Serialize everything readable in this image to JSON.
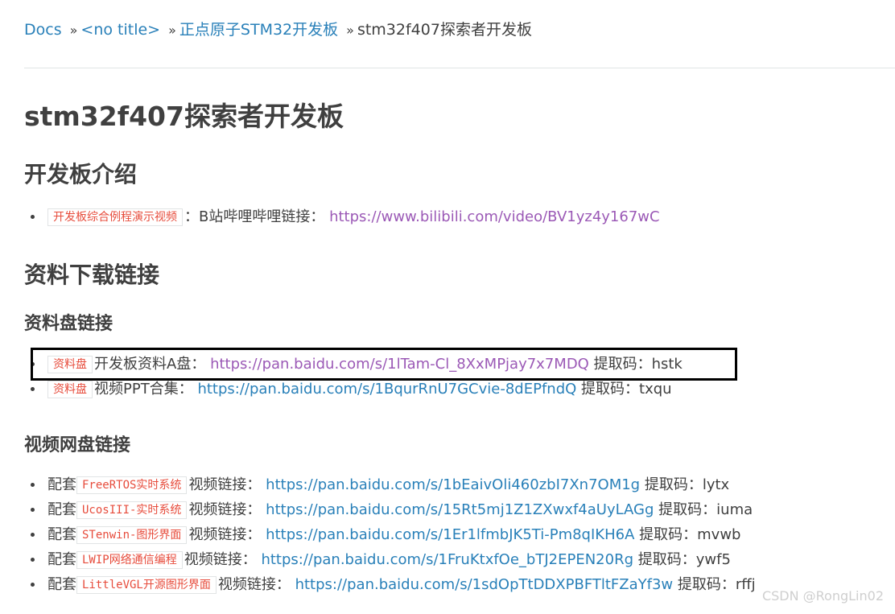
{
  "breadcrumb": {
    "items": [
      "Docs",
      "<no title>",
      "正点原子STM32开发板"
    ],
    "current": "stm32f407探索者开发板",
    "separator": "»"
  },
  "title": "stm32f407探索者开发板",
  "section_intro": {
    "heading": "开发板介绍",
    "items": [
      {
        "tag": "开发板综合例程演示视频",
        "prefix": "",
        "text": "：B站哔哩哔哩链接：",
        "link": "https://www.bilibili.com/video/BV1yz4y167wC",
        "suffix": ""
      }
    ]
  },
  "section_download": {
    "heading": "资料下载链接",
    "disk_links": {
      "heading": "资料盘链接",
      "items": [
        {
          "tag": "资料盘",
          "text": "开发板资料A盘：",
          "link": "https://pan.baidu.com/s/1lTam-Cl_8XxMPjay7x7MDQ",
          "suffix": "提取码：hstk"
        },
        {
          "tag": "资料盘",
          "text": "视频PPT合集：",
          "link": "https://pan.baidu.com/s/1BqurRnU7GCvie-8dEPfndQ",
          "suffix": "提取码：txqu"
        }
      ]
    },
    "video_links": {
      "heading": "视频网盘链接",
      "items": [
        {
          "prefix": "配套",
          "tag": "FreeRTOS实时系统",
          "text": "视频链接：",
          "link": "https://pan.baidu.com/s/1bEaivOli460zbI7Xn7OM1g",
          "suffix": "提取码：lytx"
        },
        {
          "prefix": "配套",
          "tag": "UcosIII-实时系统",
          "text": "视频链接：",
          "link": "https://pan.baidu.com/s/15Rt5mj1Z1ZXwxf4aUyLAGg",
          "suffix": "提取码：iuma"
        },
        {
          "prefix": "配套",
          "tag": "STenwin-图形界面",
          "text": "视频链接：",
          "link": "https://pan.baidu.com/s/1Er1lfmbJK5Ti-Pm8qIKH6A",
          "suffix": "提取码：mvwb"
        },
        {
          "prefix": "配套",
          "tag": "LWIP网络通信编程",
          "text": "视频链接：",
          "link": "https://pan.baidu.com/s/1FruKtxfOe_bTJ2EPEN20Rg",
          "suffix": "提取码：ywf5"
        },
        {
          "prefix": "配套",
          "tag": "LittleVGL开源图形界面",
          "text": "视频链接：",
          "link": "https://pan.baidu.com/s/1sdOpTtDDXPBFTltFZaYf3w",
          "suffix": "提取码：rffj"
        }
      ]
    }
  },
  "watermark": "CSDN @RongLin02",
  "colors": {
    "link": "#2980b9",
    "visited_link": "#9b59b6",
    "code": "#e74c3c",
    "text": "#404040"
  }
}
